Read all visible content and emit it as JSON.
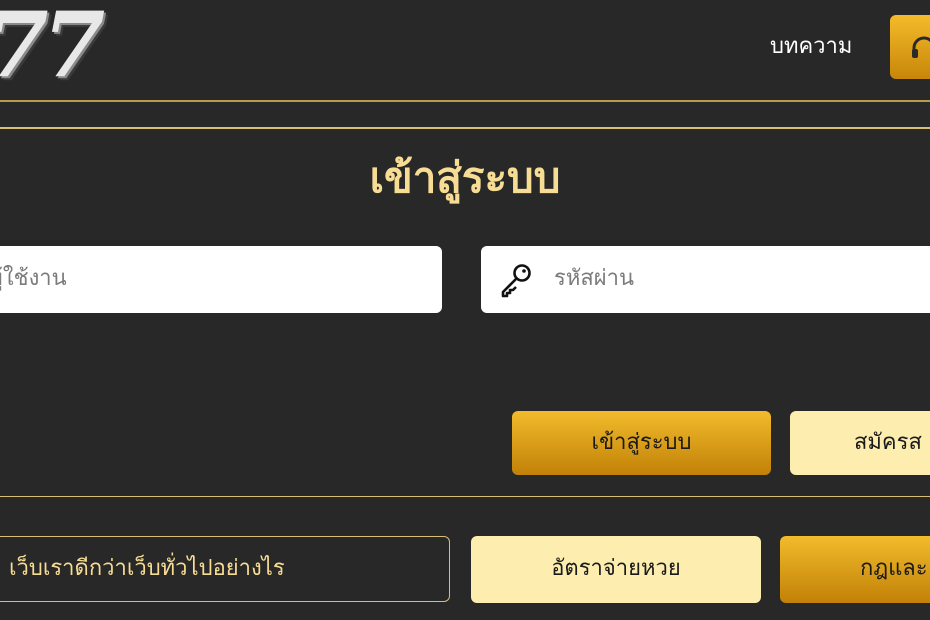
{
  "header": {
    "logo_text": "77",
    "nav_link_label": "บทความ",
    "support_icon": "headset-icon"
  },
  "login": {
    "title": "เข้าสู่ระบบ",
    "username_placeholder": "ผู้ใช้งาน",
    "password_placeholder": "รหัสผ่าน",
    "password_icon": "key-icon",
    "login_button": "เข้าสู่ระบบ",
    "register_button": "สมัครส"
  },
  "footer_links": {
    "why_us": "เว็บเราดีกว่าเว็บทั่วไปอย่างไร",
    "rates": "อัตราจ่ายหวย",
    "rules": "กฎและ"
  },
  "colors": {
    "background": "#282828",
    "accent_gold": "#e3a51a",
    "accent_cream": "#fdeeb0",
    "title_gold": "#f7dc93"
  }
}
